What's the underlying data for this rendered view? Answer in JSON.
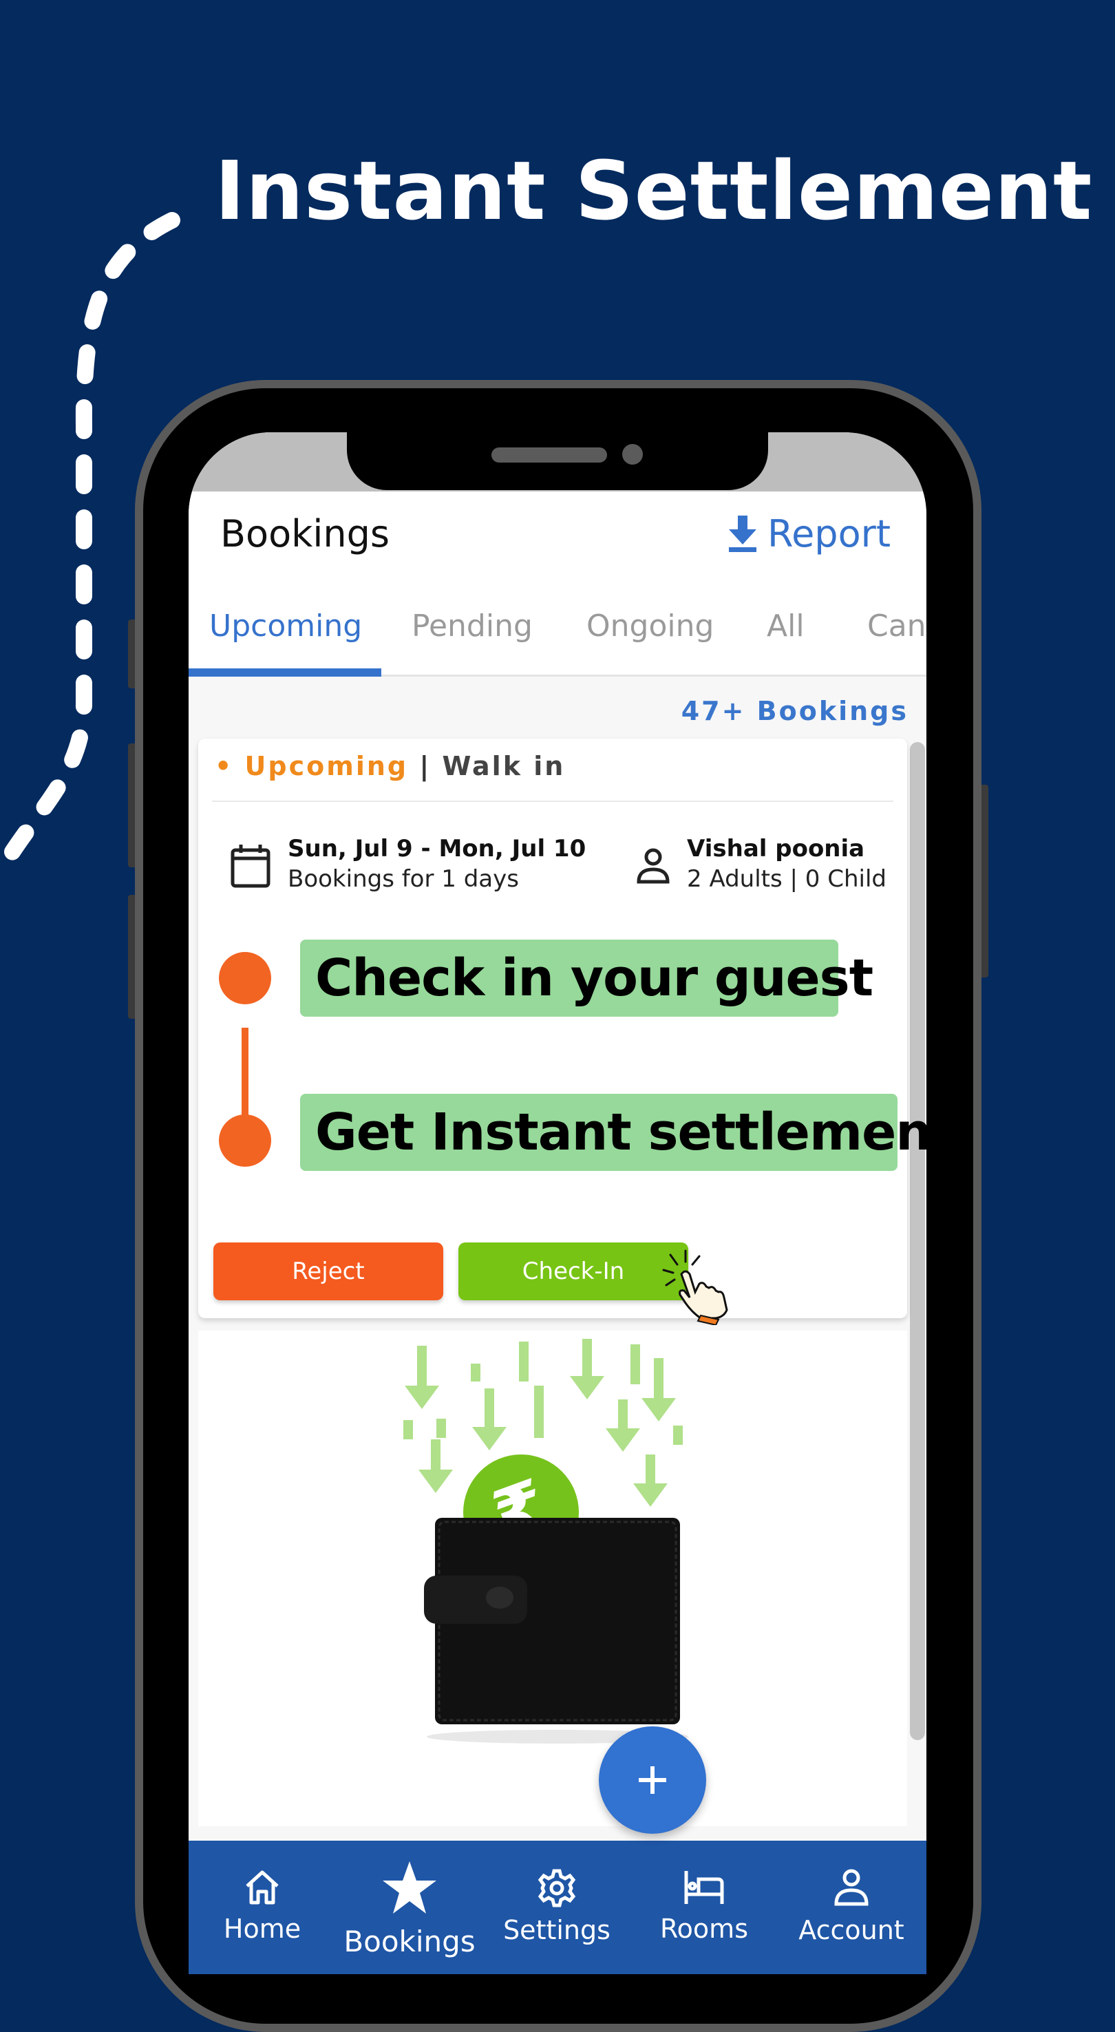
{
  "headline": "Instant Settlement",
  "app": {
    "title": "Bookings",
    "report_label": "Report",
    "report_icon": "download-icon",
    "tabs": [
      {
        "label": "Upcoming",
        "active": true
      },
      {
        "label": "Pending",
        "active": false
      },
      {
        "label": "Ongoing",
        "active": false
      },
      {
        "label": "All",
        "active": false
      },
      {
        "label": "Canc",
        "active": false
      }
    ],
    "bookings_count": "47+ Bookings"
  },
  "booking_card": {
    "status_dot": "•",
    "status": "Upcoming",
    "separator": "|",
    "type": "Walk in",
    "dates": "Sun, Jul 9 - Mon, Jul 10",
    "duration": "Bookings for 1 days",
    "guest_name": "Vishal poonia",
    "guest_count": "2 Adults | 0 Child",
    "reject_label": "Reject",
    "checkin_label": "Check-In"
  },
  "steps": [
    {
      "label": "Check in your guest"
    },
    {
      "label": "Get Instant settlement"
    }
  ],
  "promo": {
    "currency_symbol": "₹",
    "icon": "wallet-icon"
  },
  "fab_label": "+",
  "bottom_nav": [
    {
      "label": "Home",
      "icon": "home-icon",
      "active": false
    },
    {
      "label": "Bookings",
      "icon": "star-icon",
      "active": true
    },
    {
      "label": "Settings",
      "icon": "gear-icon",
      "active": false
    },
    {
      "label": "Rooms",
      "icon": "bed-icon",
      "active": false
    },
    {
      "label": "Account",
      "icon": "person-icon",
      "active": false
    }
  ],
  "colors": {
    "background": "#042a5e",
    "primary_blue": "#3572cc",
    "nav_blue": "#1f56a6",
    "orange": "#f26422",
    "status_orange": "#f08a1c",
    "green_button": "#77c414",
    "step_green": "#96d99a"
  }
}
